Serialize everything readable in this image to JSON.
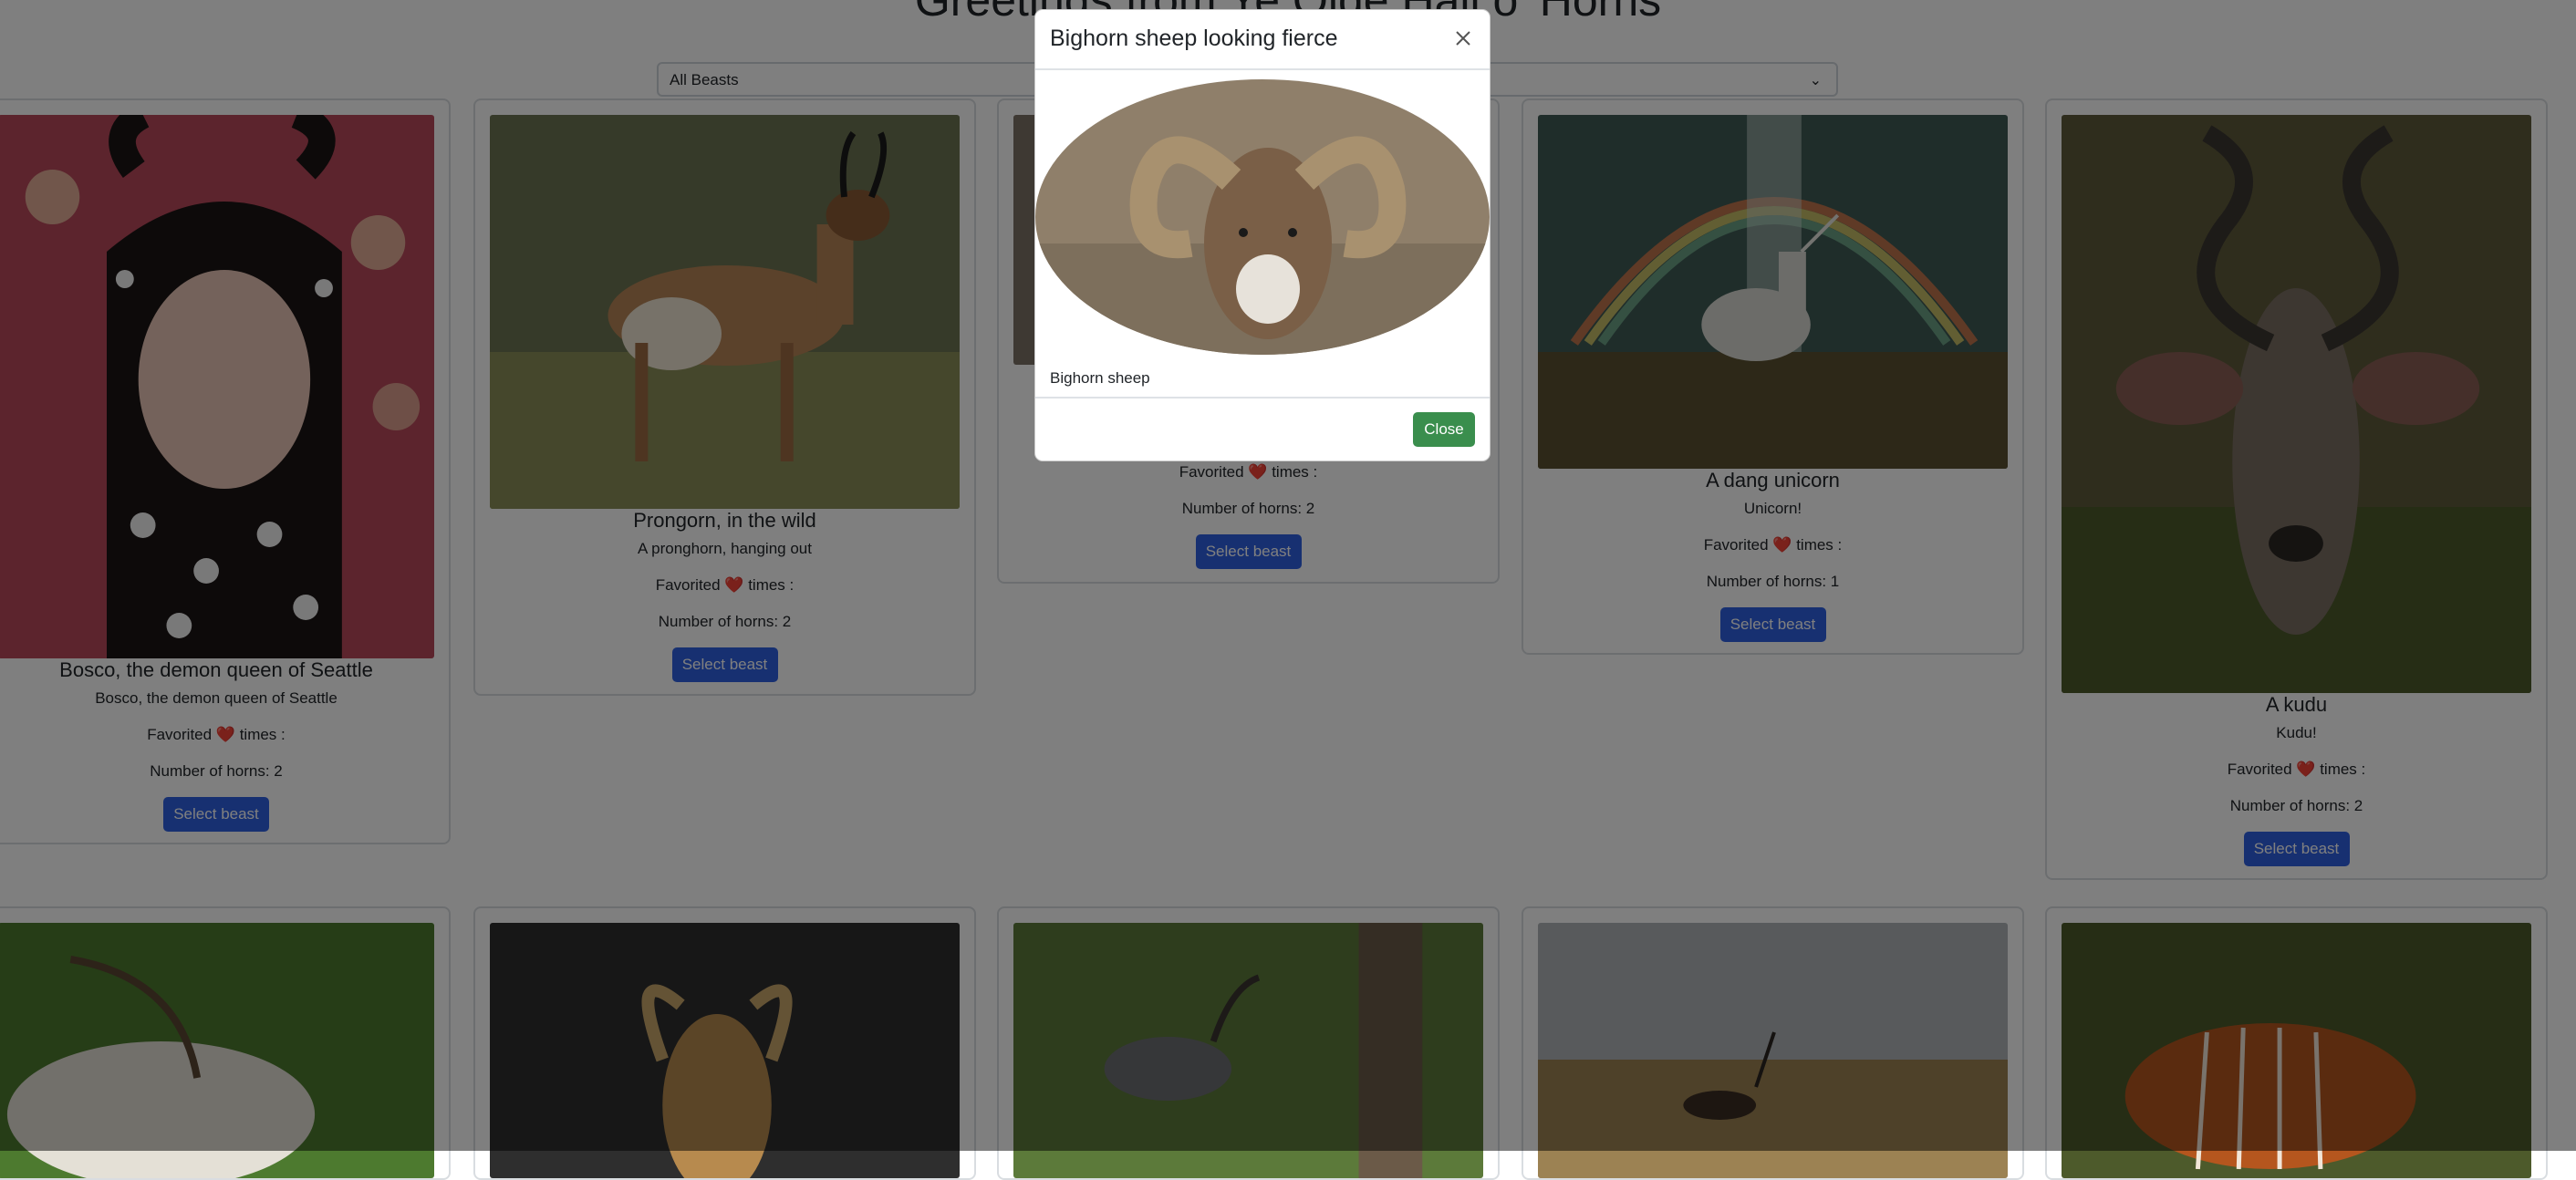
{
  "page": {
    "title": "Greetings from Ye Olde Hall o' Horns"
  },
  "filter": {
    "selected": "All Beasts"
  },
  "cards": [
    {
      "title": "Bosco, the demon queen of Seattle",
      "description": "Bosco, the demon queen of Seattle",
      "favorited": "Favorited ❤️ times :",
      "horns": "Number of horns: 2",
      "button": "Select beast"
    },
    {
      "title": "Prongorn, in the wild",
      "description": "A pronghorn, hanging out",
      "favorited": "Favorited ❤️ times :",
      "horns": "Number of horns: 2",
      "button": "Select beast"
    },
    {
      "favorited": "Favorited ❤️ times :",
      "horns": "Number of horns: 2",
      "button": "Select beast"
    },
    {
      "title": "A dang unicorn",
      "description": "Unicorn!",
      "favorited": "Favorited ❤️ times :",
      "horns": "Number of horns: 1",
      "button": "Select beast"
    },
    {
      "title": "A kudu",
      "description": "Kudu!",
      "favorited": "Favorited ❤️ times :",
      "horns": "Number of horns: 2",
      "button": "Select beast"
    }
  ],
  "modal": {
    "title": "Bighorn sheep looking fierce",
    "caption": "Bighorn sheep",
    "close_button": "Close"
  },
  "colors": {
    "primary": "#2f61e3",
    "success": "#3a8e4d",
    "backdrop": "rgba(0,0,0,0.5)"
  }
}
